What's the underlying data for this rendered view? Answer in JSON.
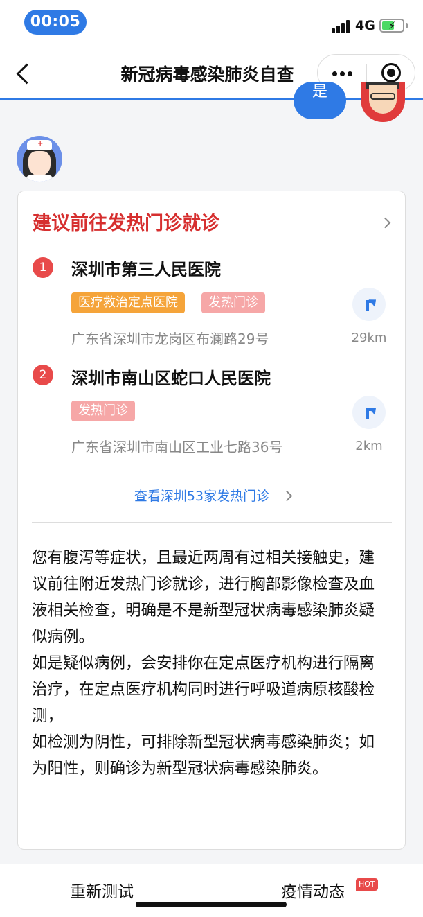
{
  "status_bar": {
    "time": "00:05",
    "network": "4G",
    "signal_bars": 4,
    "battery_level": 0.6,
    "battery_color": "#4cd964"
  },
  "nav": {
    "title": "新冠病毒感染肺炎自查",
    "back_icon": "chevron-left-icon",
    "more_icon": "more-dots-icon",
    "close_icon": "mini-program-close-icon"
  },
  "chat": {
    "user_bubble_text": "是"
  },
  "card": {
    "title": "建议前往发热门诊就诊",
    "hospitals": [
      {
        "index": "1",
        "name": "深圳市第三人民医院",
        "tags": [
          "医疗救治定点医院",
          "发热门诊"
        ],
        "address": "广东省深圳市龙岗区布澜路29号",
        "distance": "29km"
      },
      {
        "index": "2",
        "name": "深圳市南山区蛇口人民医院",
        "tags": [
          "发热门诊"
        ],
        "address": "广东省深圳市南山区工业七路36号",
        "distance": "2km"
      }
    ],
    "more_link": "查看深圳53家发热门诊",
    "advice": [
      "您有腹泻等症状，且最近两周有过相关接触史，建议前往附近发热门诊就诊，进行胸部影像检查及血液相关检查，明确是不是新型冠状病毒感染肺炎疑似病例。",
      "如是疑似病例，会安排你在定点医疗机构进行隔离治疗，在定点医疗机构同时进行呼吸道病原核酸检测，",
      "如检测为阴性，可排除新型冠状病毒感染肺炎；如为阳性，则确诊为新型冠状病毒感染肺炎。"
    ]
  },
  "bottom": {
    "retest_label": "重新测试",
    "epidemic_label": "疫情动态",
    "hot_badge": "HOT"
  },
  "colors": {
    "accent_blue": "#2f7ae5",
    "title_red": "#d62f2f",
    "tag_orange": "#f5a43a",
    "tag_pink": "#f6a7a7",
    "index_red": "#e84a4a"
  }
}
